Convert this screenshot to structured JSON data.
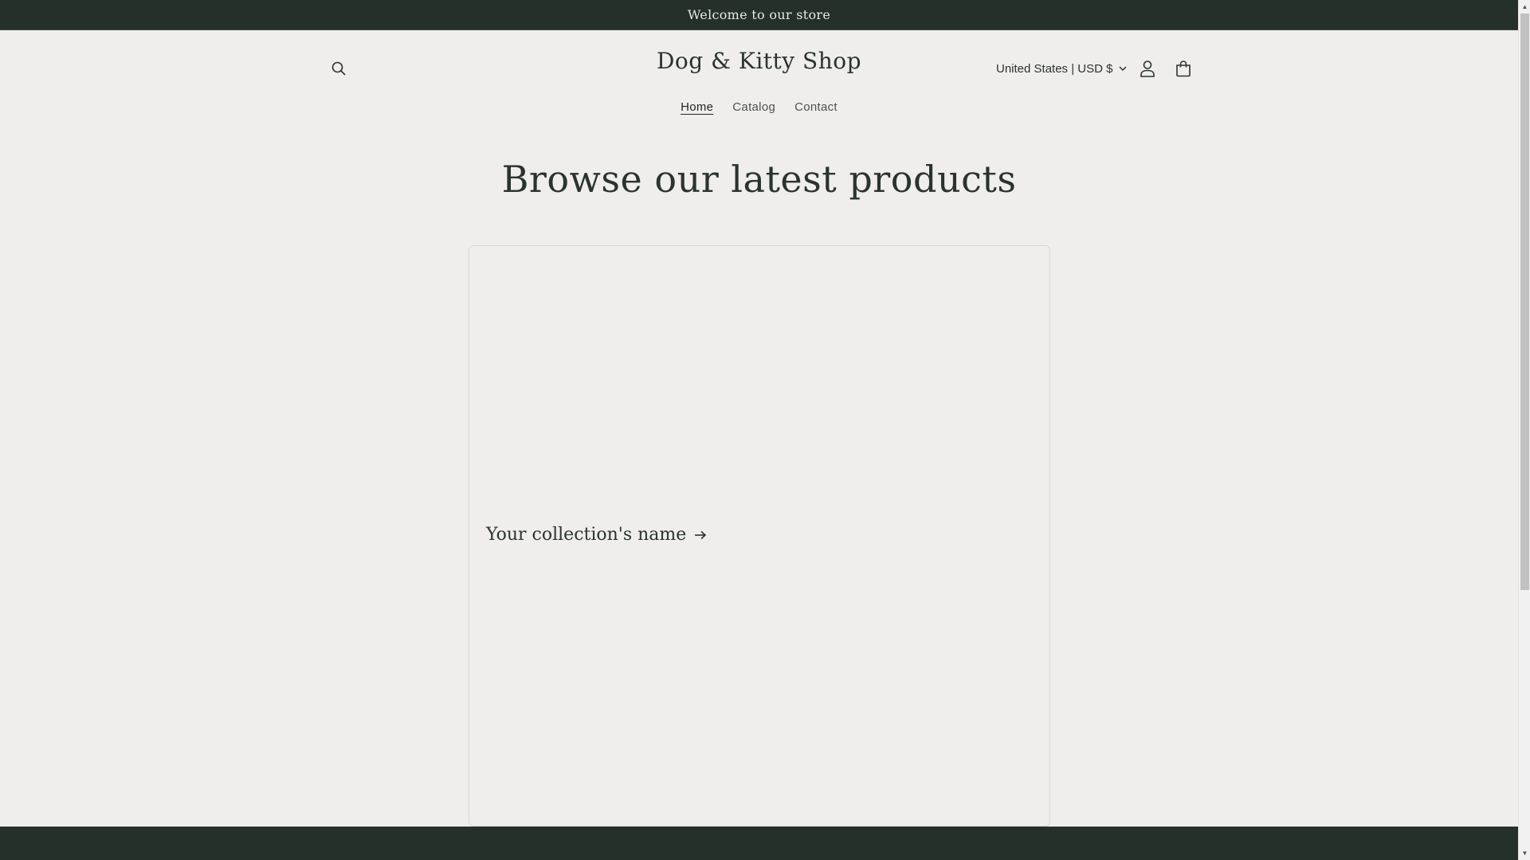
{
  "announcement": {
    "text": "Welcome to our store"
  },
  "header": {
    "logo": "Dog & Kitty Shop",
    "currency": "United States | USD $",
    "icons": {
      "search": "search-icon",
      "account": "account-icon",
      "cart": "cart-icon",
      "currency_chevron": "chevron-down-icon"
    }
  },
  "nav": {
    "items": [
      {
        "label": "Home",
        "active": true
      },
      {
        "label": "Catalog",
        "active": false
      },
      {
        "label": "Contact",
        "active": false
      }
    ]
  },
  "main": {
    "section_title": "Browse our latest products",
    "collection": {
      "title": "Your collection's name",
      "icon": "arrow-right-icon"
    }
  },
  "colors": {
    "background": "#efeeec",
    "dark_band": "#25302b",
    "text": "#2b332f"
  }
}
